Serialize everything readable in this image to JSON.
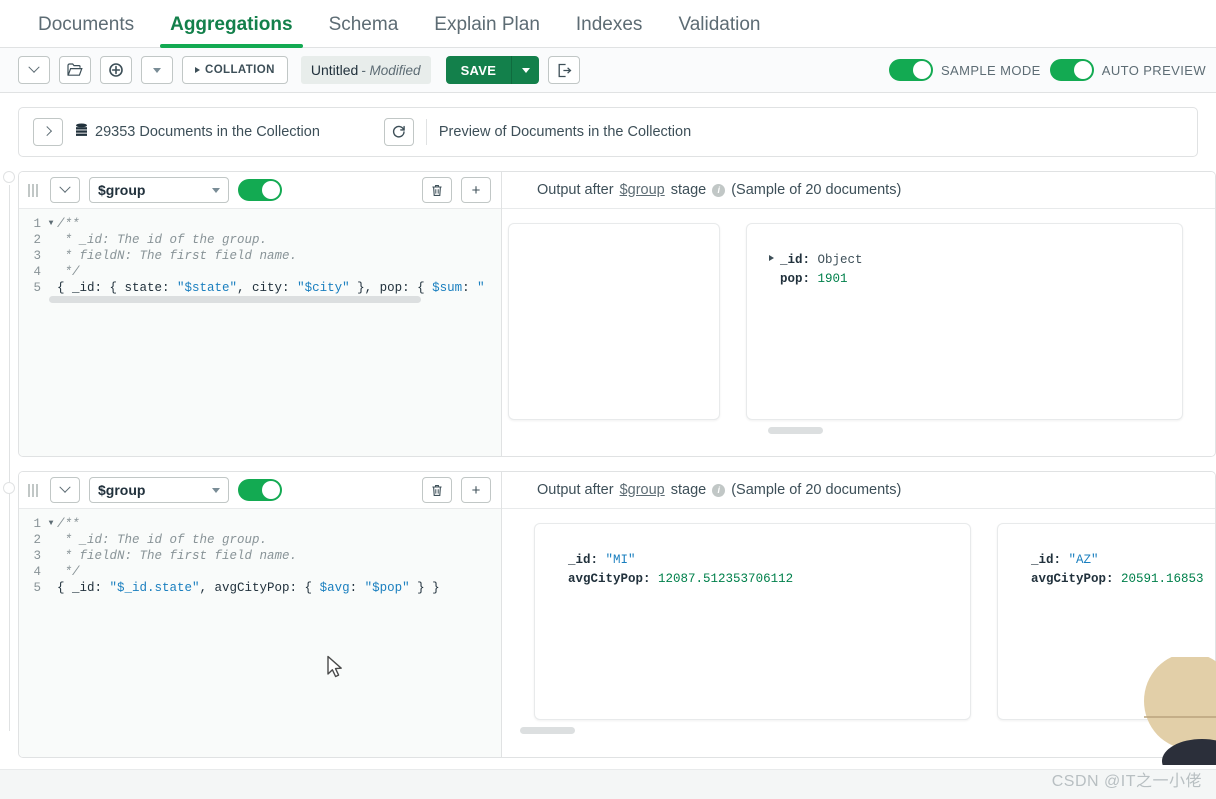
{
  "tabs": [
    {
      "label": "Documents",
      "active": false
    },
    {
      "label": "Aggregations",
      "active": true
    },
    {
      "label": "Schema",
      "active": false
    },
    {
      "label": "Explain Plan",
      "active": false
    },
    {
      "label": "Indexes",
      "active": false
    },
    {
      "label": "Validation",
      "active": false
    }
  ],
  "toolbar": {
    "collation_label": "COLLATION",
    "pipeline_name": "Untitled",
    "pipeline_state": "- Modified",
    "save_label": "SAVE",
    "sample_mode_label": "SAMPLE MODE",
    "auto_preview_label": "AUTO PREVIEW",
    "sample_mode_on": true,
    "auto_preview_on": true,
    "icons": {
      "history": "chevron-down-icon",
      "open": "folder-open-icon",
      "new": "plus-circle-icon",
      "new_caret": "caret-down-icon",
      "export": "export-icon"
    }
  },
  "collection_bar": {
    "expand_icon": "chevron-right-icon",
    "db_icon": "database-icon",
    "count_text": "29353 Documents in the Collection",
    "refresh_icon": "refresh-icon",
    "preview_text": "Preview of Documents in the Collection"
  },
  "stages": [
    {
      "operator": "$group",
      "enabled": true,
      "delete_icon": "trash-icon",
      "add_icon": "plus-icon",
      "collapse_icon": "chevron-down-icon",
      "drag_icon": "drag-handle-icon",
      "code_lines": [
        {
          "num": "1",
          "fold": true,
          "text": "/**"
        },
        {
          "num": "2",
          "fold": false,
          "text": " * _id: The id of the group."
        },
        {
          "num": "3",
          "fold": false,
          "text": " * fieldN: The first field name."
        },
        {
          "num": "4",
          "fold": false,
          "text": " */"
        },
        {
          "num": "5",
          "fold": false,
          "text": "{ _id: { state: \"$state\", city: \"$city\" }, pop: { $sum: \""
        }
      ],
      "output": {
        "title_prefix": "Output after",
        "operator_link": "$group",
        "title_suffix": "stage",
        "info_icon": "info-icon",
        "sample_text": "(Sample of 20 documents)",
        "documents": [
          {
            "fields": []
          },
          {
            "fields": [
              {
                "key": "_id",
                "value": "Object",
                "kind": "object",
                "expandable": true
              },
              {
                "key": "pop",
                "value": "1901",
                "kind": "number",
                "expandable": false
              }
            ]
          }
        ]
      }
    },
    {
      "operator": "$group",
      "enabled": true,
      "delete_icon": "trash-icon",
      "add_icon": "plus-icon",
      "collapse_icon": "chevron-down-icon",
      "drag_icon": "drag-handle-icon",
      "code_lines": [
        {
          "num": "1",
          "fold": true,
          "text": "/**"
        },
        {
          "num": "2",
          "fold": false,
          "text": " * _id: The id of the group."
        },
        {
          "num": "3",
          "fold": false,
          "text": " * fieldN: The first field name."
        },
        {
          "num": "4",
          "fold": false,
          "text": " */"
        },
        {
          "num": "5",
          "fold": false,
          "text": "{ _id: \"$_id.state\", avgCityPop: { $avg: \"$pop\" } }"
        }
      ],
      "output": {
        "title_prefix": "Output after",
        "operator_link": "$group",
        "title_suffix": "stage",
        "info_icon": "info-icon",
        "sample_text": "(Sample of 20 documents)",
        "documents": [
          {
            "fields": [
              {
                "key": "_id",
                "value": "\"MI\"",
                "kind": "string",
                "expandable": false
              },
              {
                "key": "avgCityPop",
                "value": "12087.512353706112",
                "kind": "number",
                "expandable": false
              }
            ]
          },
          {
            "fields": [
              {
                "key": "_id",
                "value": "\"AZ\"",
                "kind": "string",
                "expandable": false
              },
              {
                "key": "avgCityPop",
                "value": "20591.16853",
                "kind": "number",
                "expandable": false
              }
            ]
          }
        ]
      }
    }
  ],
  "watermark": "CSDN @IT之一小佬",
  "colors": {
    "brand_green": "#13aa52",
    "save_green": "#13804b",
    "text": "#3d4f58",
    "muted": "#889397",
    "border": "#e0e2e3",
    "string_blue": "#1a7fbf",
    "number_green": "#00804b"
  }
}
